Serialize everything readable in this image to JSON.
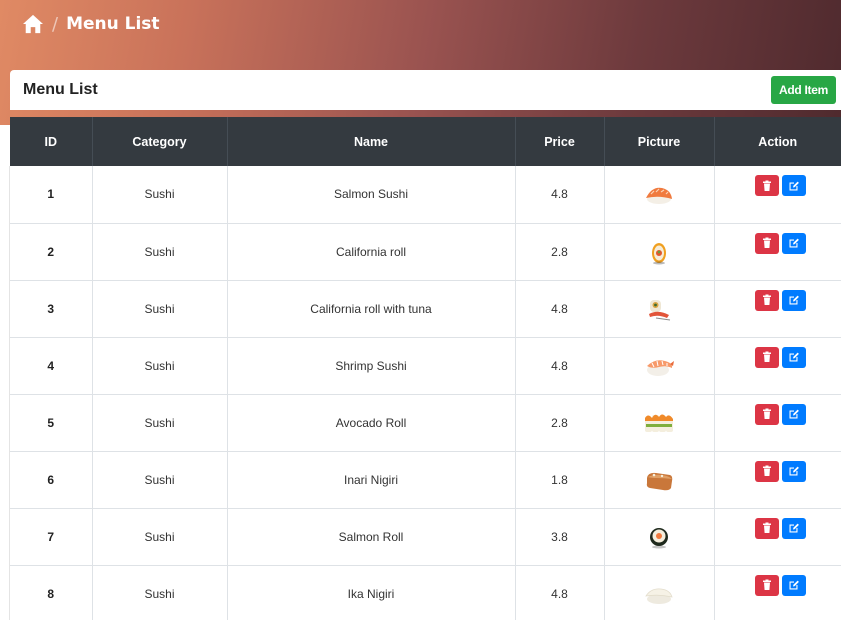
{
  "breadcrumb": {
    "separator": "/",
    "current": "Menu List"
  },
  "card": {
    "title": "Menu List",
    "add_label": "Add Item"
  },
  "table": {
    "headers": [
      "ID",
      "Category",
      "Name",
      "Price",
      "Picture",
      "Action"
    ],
    "rows": [
      {
        "id": "1",
        "category": "Sushi",
        "name": "Salmon Sushi",
        "price": "4.8",
        "picture": "salmon-sushi-image"
      },
      {
        "id": "2",
        "category": "Sushi",
        "name": "California roll",
        "price": "2.8",
        "picture": "california-roll-image"
      },
      {
        "id": "3",
        "category": "Sushi",
        "name": "California roll with tuna",
        "price": "4.8",
        "picture": "california-roll-tuna-image"
      },
      {
        "id": "4",
        "category": "Sushi",
        "name": "Shrimp Sushi",
        "price": "4.8",
        "picture": "shrimp-sushi-image"
      },
      {
        "id": "5",
        "category": "Sushi",
        "name": "Avocado Roll",
        "price": "2.8",
        "picture": "avocado-roll-image"
      },
      {
        "id": "6",
        "category": "Sushi",
        "name": "Inari Nigiri",
        "price": "1.8",
        "picture": "inari-nigiri-image"
      },
      {
        "id": "7",
        "category": "Sushi",
        "name": "Salmon Roll",
        "price": "3.8",
        "picture": "salmon-roll-image"
      },
      {
        "id": "8",
        "category": "Sushi",
        "name": "Ika Nigiri",
        "price": "4.8",
        "picture": "ika-nigiri-image"
      }
    ]
  },
  "icons": {
    "home": "home-icon",
    "delete": "trash-icon",
    "edit": "edit-icon"
  },
  "colors": {
    "header_dark": "#343a40",
    "add_button": "#28a745",
    "delete_button": "#dc3545",
    "edit_button": "#007bff",
    "gradient_start": "#e08a64",
    "gradient_end": "#4f2a2e"
  }
}
